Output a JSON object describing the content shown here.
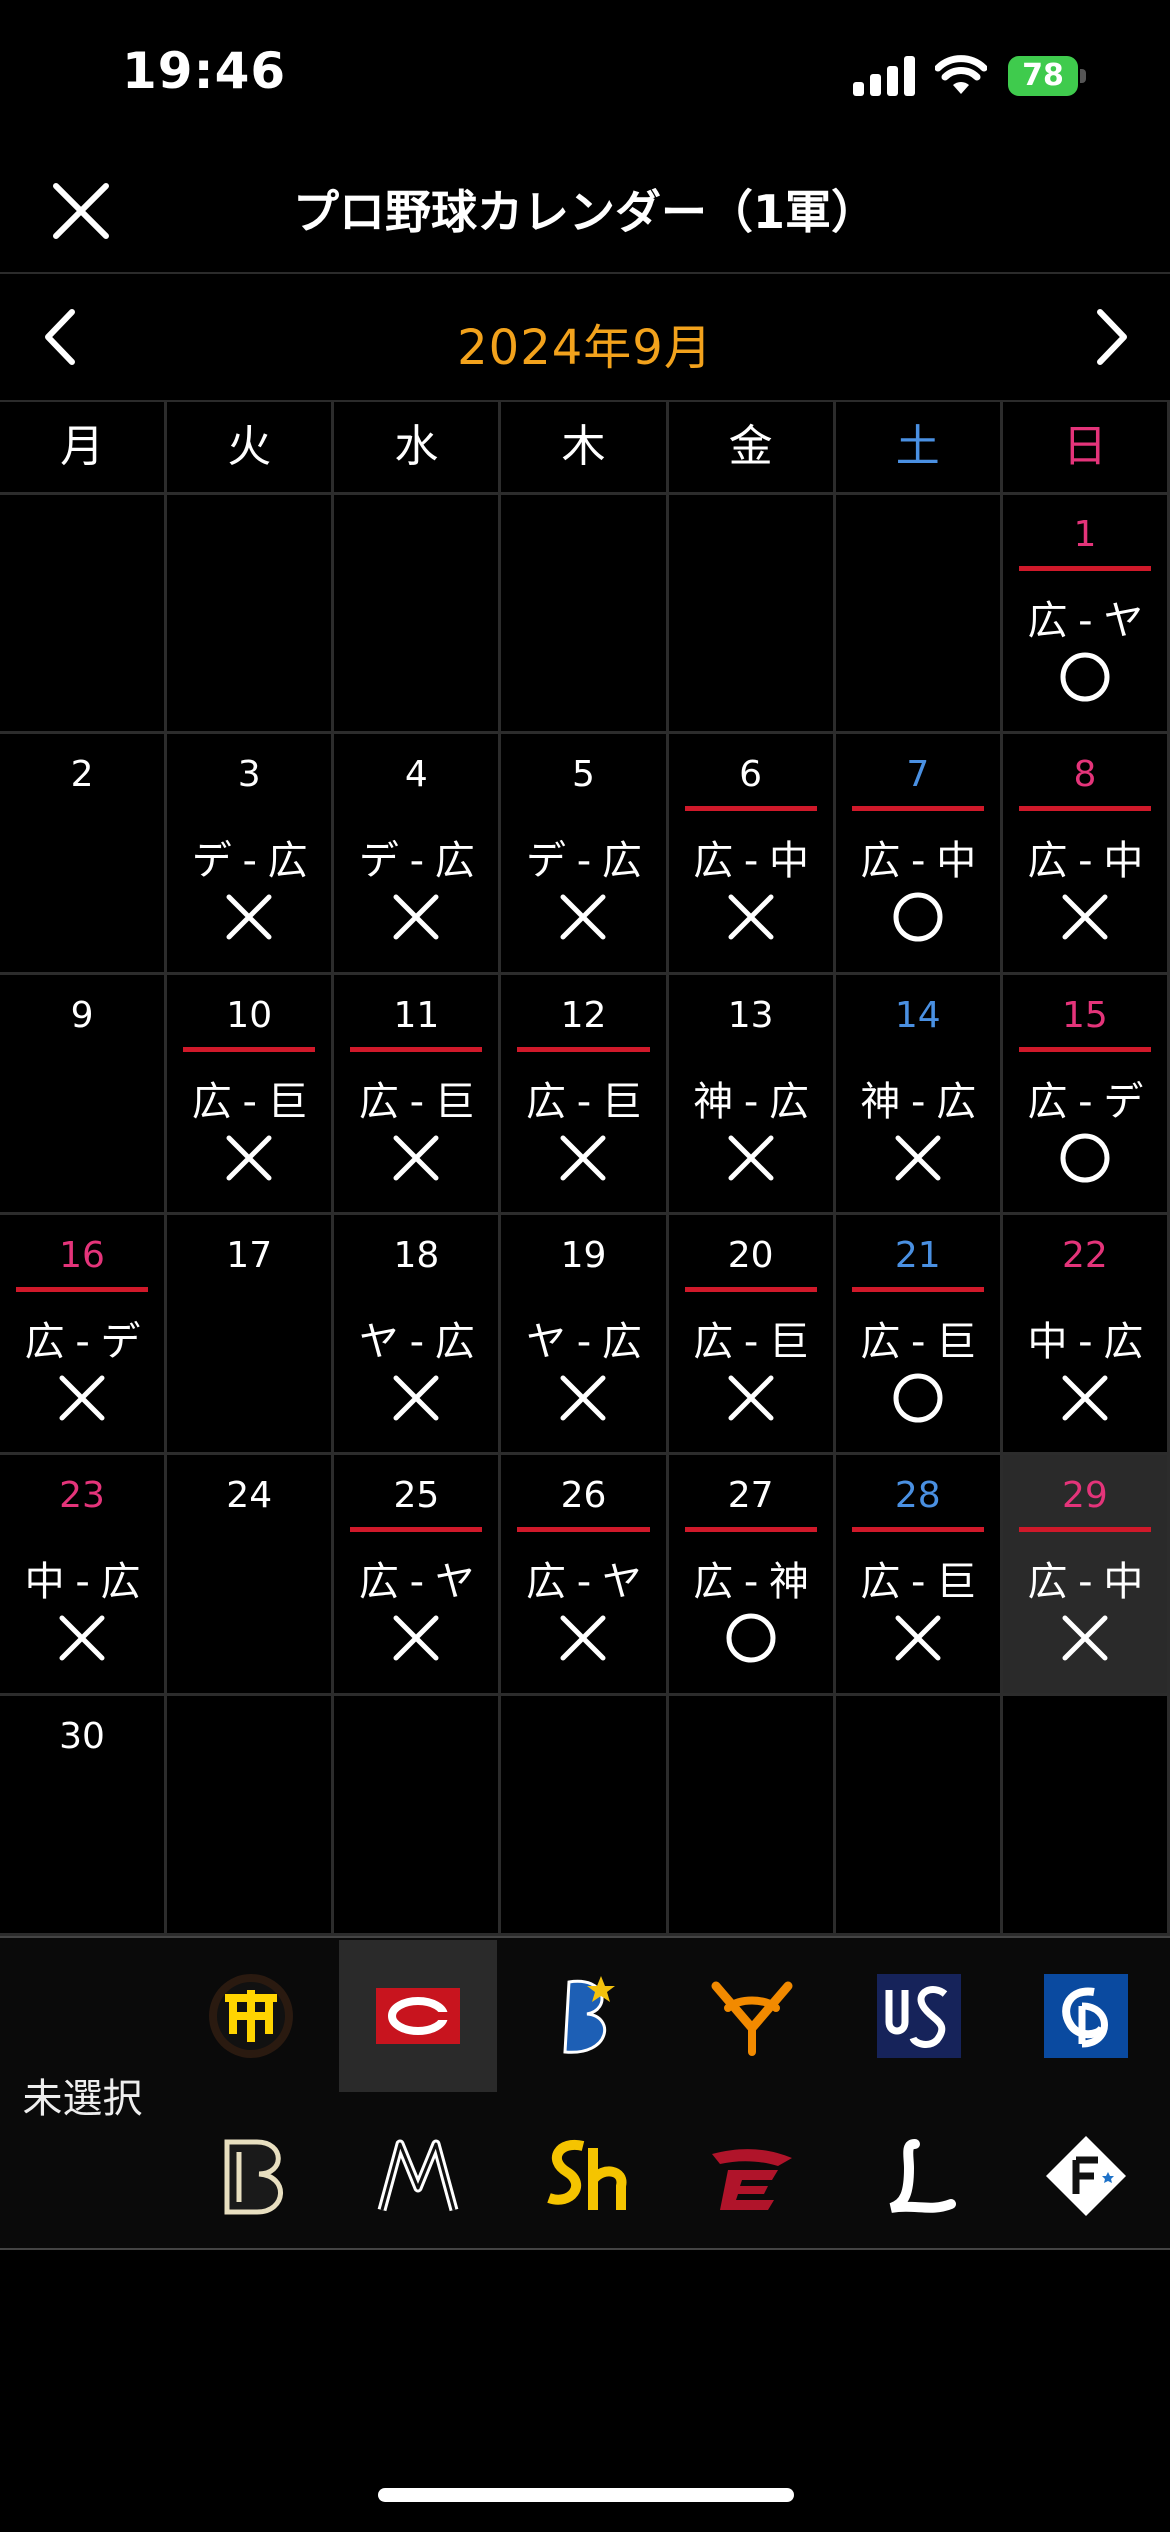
{
  "status_bar": {
    "time": "19:46",
    "battery": "78"
  },
  "header": {
    "title": "プロ野球カレンダー（1軍）"
  },
  "month_nav": {
    "label": "2024年9月"
  },
  "weekdays": [
    "月",
    "火",
    "水",
    "木",
    "金",
    "土",
    "日"
  ],
  "colors": {
    "accent": "#f2a21c",
    "saturday": "#4a90e2",
    "sunday": "#e4347a",
    "home_line": "#d0192a"
  },
  "calendar": {
    "rows": [
      [
        {
          "day": ""
        },
        {
          "day": ""
        },
        {
          "day": ""
        },
        {
          "day": ""
        },
        {
          "day": ""
        },
        {
          "day": ""
        },
        {
          "day": "1",
          "matchup": "広 - ヤ",
          "result": "○",
          "home": true
        }
      ],
      [
        {
          "day": "2"
        },
        {
          "day": "3",
          "matchup": "デ - 広",
          "result": "×",
          "home": false
        },
        {
          "day": "4",
          "matchup": "デ - 広",
          "result": "×",
          "home": false
        },
        {
          "day": "5",
          "matchup": "デ - 広",
          "result": "×",
          "home": false
        },
        {
          "day": "6",
          "matchup": "広 - 中",
          "result": "×",
          "home": true
        },
        {
          "day": "7",
          "matchup": "広 - 中",
          "result": "○",
          "home": true
        },
        {
          "day": "8",
          "matchup": "広 - 中",
          "result": "×",
          "home": true
        }
      ],
      [
        {
          "day": "9"
        },
        {
          "day": "10",
          "matchup": "広 - 巨",
          "result": "×",
          "home": true
        },
        {
          "day": "11",
          "matchup": "広 - 巨",
          "result": "×",
          "home": true
        },
        {
          "day": "12",
          "matchup": "広 - 巨",
          "result": "×",
          "home": true
        },
        {
          "day": "13",
          "matchup": "神 - 広",
          "result": "×",
          "home": false
        },
        {
          "day": "14",
          "matchup": "神 - 広",
          "result": "×",
          "home": false
        },
        {
          "day": "15",
          "matchup": "広 - デ",
          "result": "○",
          "home": true
        }
      ],
      [
        {
          "day": "16",
          "matchup": "広 - デ",
          "result": "×",
          "home": true,
          "holiday": true
        },
        {
          "day": "17"
        },
        {
          "day": "18",
          "matchup": "ヤ - 広",
          "result": "×",
          "home": false
        },
        {
          "day": "19",
          "matchup": "ヤ - 広",
          "result": "×",
          "home": false
        },
        {
          "day": "20",
          "matchup": "広 - 巨",
          "result": "×",
          "home": true
        },
        {
          "day": "21",
          "matchup": "広 - 巨",
          "result": "○",
          "home": true
        },
        {
          "day": "22",
          "matchup": "中 - 広",
          "result": "×",
          "home": false
        }
      ],
      [
        {
          "day": "23",
          "matchup": "中 - 広",
          "result": "×",
          "home": false,
          "holiday": true
        },
        {
          "day": "24"
        },
        {
          "day": "25",
          "matchup": "広 - ヤ",
          "result": "×",
          "home": true
        },
        {
          "day": "26",
          "matchup": "広 - ヤ",
          "result": "×",
          "home": true
        },
        {
          "day": "27",
          "matchup": "広 - 神",
          "result": "○",
          "home": true
        },
        {
          "day": "28",
          "matchup": "広 - 巨",
          "result": "×",
          "home": true
        },
        {
          "day": "29",
          "matchup": "広 - 中",
          "result": "×",
          "home": true,
          "selected": true
        }
      ],
      [
        {
          "day": "30"
        },
        {
          "day": ""
        },
        {
          "day": ""
        },
        {
          "day": ""
        },
        {
          "day": ""
        },
        {
          "day": ""
        },
        {
          "day": ""
        }
      ]
    ]
  },
  "team_selector": {
    "unselected_label": "未選択",
    "central": [
      "hanshin-tigers-logo",
      "hiroshima-carp-logo",
      "yokohama-baystars-logo",
      "yomiuri-giants-logo",
      "yakult-swallows-logo",
      "chunichi-dragons-logo"
    ],
    "pacific": [
      "orix-buffaloes-logo",
      "chiba-lotte-marines-logo",
      "softbank-hawks-logo",
      "rakuten-eagles-logo",
      "seibu-lions-logo",
      "nippon-ham-fighters-logo"
    ],
    "selected_team": "hiroshima-carp-logo"
  }
}
